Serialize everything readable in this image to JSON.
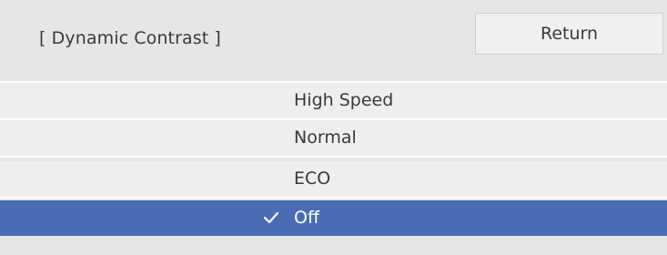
{
  "dialog": {
    "title": "[ Dynamic Contrast ]",
    "return_label": "Return"
  },
  "options": [
    {
      "label": "High Speed",
      "selected": false
    },
    {
      "label": "Normal",
      "selected": false
    },
    {
      "label": "ECO",
      "selected": false
    },
    {
      "label": "Off",
      "selected": true
    }
  ],
  "colors": {
    "selected_background": "#4a6cb5",
    "panel_background": "#e6e6e6",
    "option_background": "#eeeeee"
  },
  "icons": {
    "selected_marker": "check-icon"
  }
}
